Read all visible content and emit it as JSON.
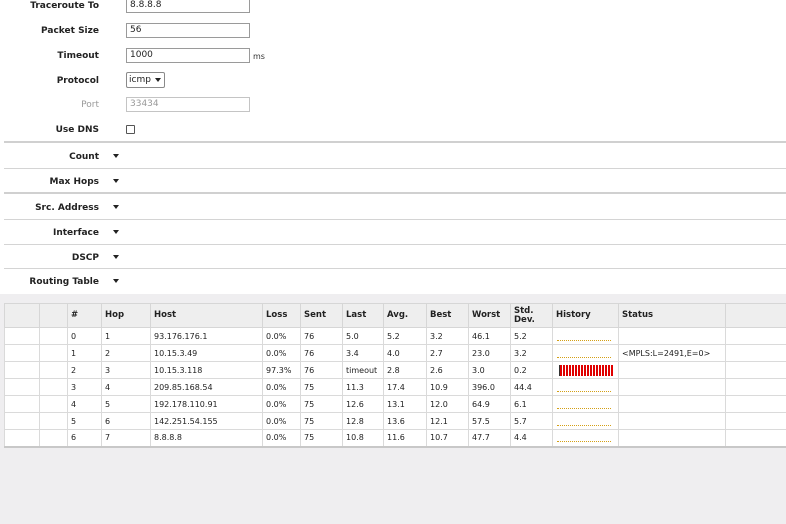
{
  "form": {
    "traceroute_to": {
      "label": "Traceroute To",
      "value": "8.8.8.8"
    },
    "packet_size": {
      "label": "Packet Size",
      "value": "56"
    },
    "timeout": {
      "label": "Timeout",
      "value": "1000",
      "unit": "ms"
    },
    "protocol": {
      "label": "Protocol",
      "value": "icmp"
    },
    "port": {
      "label": "Port",
      "placeholder": "33434"
    },
    "use_dns": {
      "label": "Use DNS",
      "checked": false
    }
  },
  "sections": {
    "count": "Count",
    "max_hops": "Max Hops",
    "src_address": "Src. Address",
    "interface": "Interface",
    "dscp": "DSCP",
    "routing_table": "Routing Table"
  },
  "table": {
    "headers": {
      "num": "#",
      "hop": "Hop",
      "host": "Host",
      "loss": "Loss",
      "sent": "Sent",
      "last": "Last",
      "avg": "Avg.",
      "best": "Best",
      "worst": "Worst",
      "std_dev": "Std. Dev.",
      "history": "History",
      "status": "Status"
    },
    "rows": [
      {
        "num": "0",
        "hop": "1",
        "host": "93.176.176.1",
        "loss": "0.0%",
        "sent": "76",
        "last": "5.0",
        "avg": "5.2",
        "best": "3.2",
        "worst": "46.1",
        "std_dev": "5.2",
        "history": "ok",
        "status": ""
      },
      {
        "num": "1",
        "hop": "2",
        "host": "10.15.3.49",
        "loss": "0.0%",
        "sent": "76",
        "last": "3.4",
        "avg": "4.0",
        "best": "2.7",
        "worst": "23.0",
        "std_dev": "3.2",
        "history": "ok",
        "status": "<MPLS:L=2491,E=0>"
      },
      {
        "num": "2",
        "hop": "3",
        "host": "10.15.3.118",
        "loss": "97.3%",
        "sent": "76",
        "last": "timeout",
        "avg": "2.8",
        "best": "2.6",
        "worst": "3.0",
        "std_dev": "0.2",
        "history": "loss",
        "status": ""
      },
      {
        "num": "3",
        "hop": "4",
        "host": "209.85.168.54",
        "loss": "0.0%",
        "sent": "75",
        "last": "11.3",
        "avg": "17.4",
        "best": "10.9",
        "worst": "396.0",
        "std_dev": "44.4",
        "history": "ok",
        "status": ""
      },
      {
        "num": "4",
        "hop": "5",
        "host": "192.178.110.91",
        "loss": "0.0%",
        "sent": "75",
        "last": "12.6",
        "avg": "13.1",
        "best": "12.0",
        "worst": "64.9",
        "std_dev": "6.1",
        "history": "ok",
        "status": ""
      },
      {
        "num": "5",
        "hop": "6",
        "host": "142.251.54.155",
        "loss": "0.0%",
        "sent": "75",
        "last": "12.8",
        "avg": "13.6",
        "best": "12.1",
        "worst": "57.5",
        "std_dev": "5.7",
        "history": "ok",
        "status": ""
      },
      {
        "num": "6",
        "hop": "7",
        "host": "8.8.8.8",
        "loss": "0.0%",
        "sent": "75",
        "last": "10.8",
        "avg": "11.6",
        "best": "10.7",
        "worst": "47.7",
        "std_dev": "4.4",
        "history": "ok",
        "status": ""
      }
    ]
  },
  "colors": {
    "history_loss": "#e00000",
    "history_ok": "#d4a017"
  },
  "icons": {
    "section_toggle": "triangle-down-icon",
    "select_caret": "chevron-down-icon"
  }
}
